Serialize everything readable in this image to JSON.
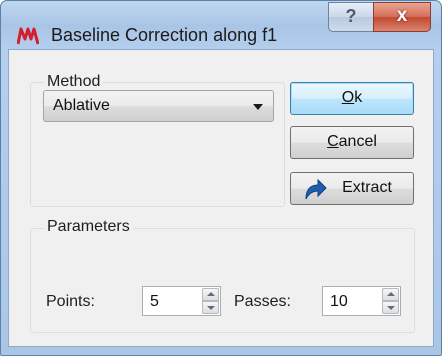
{
  "window": {
    "title": "Baseline Correction along f1",
    "help_label": "?",
    "close_label": "x"
  },
  "method_group": {
    "label": "Method",
    "selected": "Ablative"
  },
  "buttons": {
    "ok_mnemonic": "O",
    "ok_rest": "k",
    "cancel_mnemonic": "C",
    "cancel_rest": "ancel",
    "extract_label": "Extract"
  },
  "parameters_group": {
    "label": "Parameters",
    "points_label": "Points:",
    "points_value": "5",
    "passes_label": "Passes:",
    "passes_value": "10"
  },
  "colors": {
    "title_bar": "#b5cfee",
    "dialog_bg": "#f0f0f0",
    "close_button": "#c44830",
    "default_button": "#bee6fd",
    "app_icon": "#d21f2f",
    "extract_arrow": "#1c5fb2"
  },
  "icons": {
    "app": "app-logo-icon",
    "extract": "curved-arrow-icon",
    "dropdown": "chevron-down-icon"
  }
}
